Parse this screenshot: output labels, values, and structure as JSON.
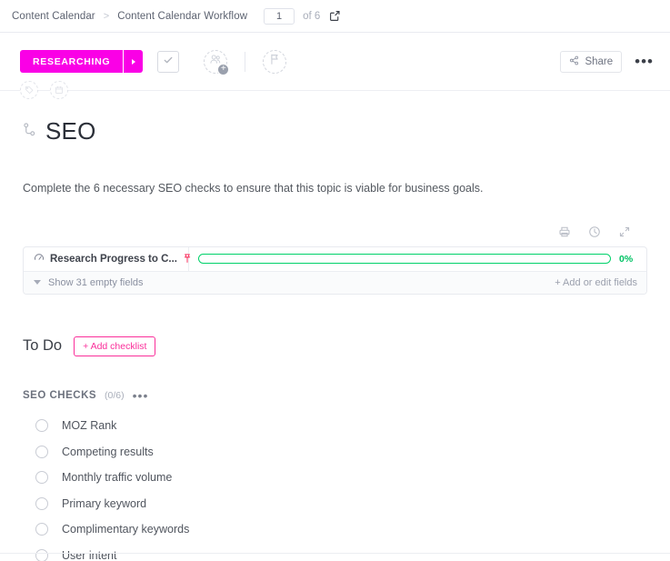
{
  "breadcrumb": {
    "items": [
      "Content Calendar",
      "Content Calendar Workflow"
    ],
    "separator": ">",
    "page_value": "1",
    "page_total_label": "of 6",
    "open_icon": "open-external-icon"
  },
  "toolbar": {
    "status_label": "RESEARCHING",
    "status_color": "#fa00e6",
    "status_caret_icon": "chevron-right-icon",
    "complete_check_icon": "check-icon",
    "assignee_icon": "add-assignee-icon",
    "flag_icon": "flag-priority-icon",
    "share_label": "Share",
    "share_icon": "share-icon",
    "more_label": "•••",
    "tag_icon": "tag-icon",
    "date_icon": "calendar-icon"
  },
  "task": {
    "subtask_icon": "subtask-branch-icon",
    "title": "SEO",
    "description": "Complete the 6 necessary SEO checks to ensure that this topic is viable for business goals."
  },
  "field_actions": {
    "print_icon": "printer-icon",
    "history_icon": "clock-history-icon",
    "expand_icon": "expand-arrows-icon"
  },
  "fields": {
    "rows": [
      {
        "icon": "progress-gauge-icon",
        "name": "Research Progress to C...",
        "pin_icon": "pin-icon",
        "progress_percent": 0,
        "progress_label": "0%",
        "progress_color": "#00d26a"
      }
    ],
    "show_empty_label": "Show 31 empty fields",
    "add_fields_label": "+ Add or edit fields"
  },
  "todo": {
    "heading": "To Do",
    "add_checklist_label": "+ Add checklist",
    "add_checklist_color": "#fa2f9a"
  },
  "checklist": {
    "name": "SEO CHECKS",
    "count_label": "(0/6)",
    "menu_label": "•••",
    "items": [
      {
        "label": "MOZ Rank",
        "checked": false
      },
      {
        "label": "Competing results",
        "checked": false
      },
      {
        "label": "Monthly traffic volume",
        "checked": false
      },
      {
        "label": "Primary keyword",
        "checked": false
      },
      {
        "label": "Complimentary keywords",
        "checked": false
      },
      {
        "label": "User intent",
        "checked": false
      }
    ]
  }
}
